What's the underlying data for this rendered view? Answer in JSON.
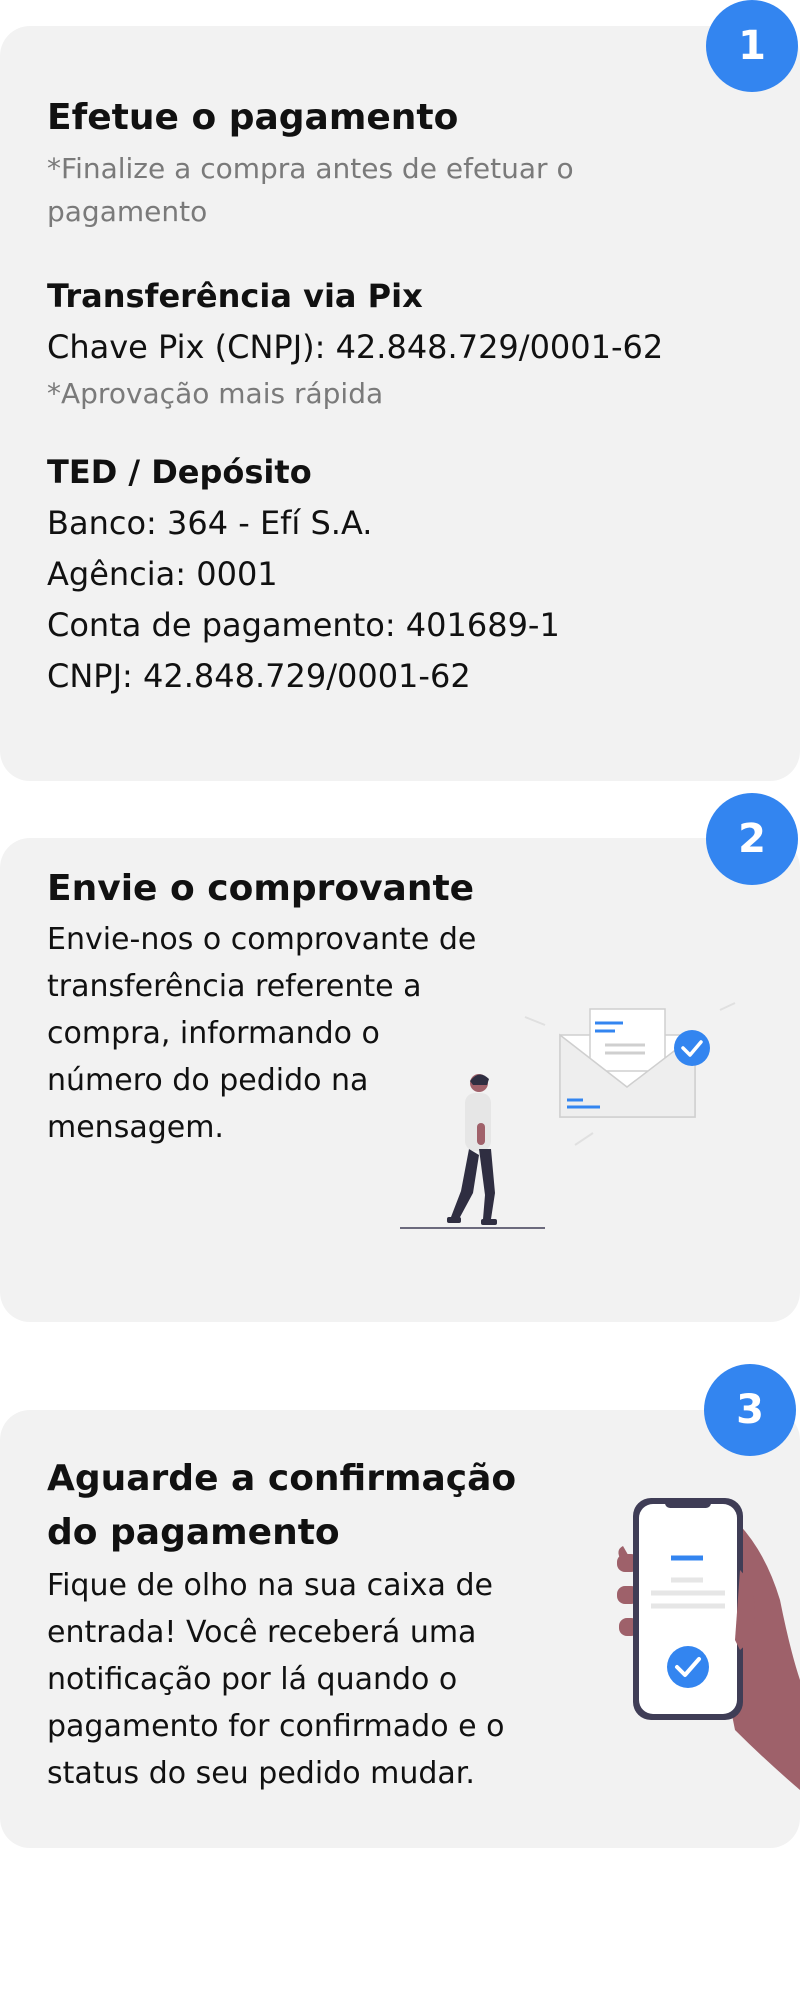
{
  "step1": {
    "number": "1",
    "title": "Efetue o pagamento",
    "note_line1": "*Finalize a compra antes de efetuar o",
    "note_line2": "pagamento",
    "pix": {
      "heading": "Transferência via Pix",
      "key": "Chave Pix (CNPJ): 42.848.729/0001-62",
      "note": "*Aprovação mais rápida"
    },
    "ted": {
      "heading": "TED / Depósito",
      "bank": "Banco: 364 - Efí S.A.",
      "agency": "Agência: 0001",
      "account": "Conta de pagamento: 401689-1",
      "cnpj": "CNPJ: 42.848.729/0001-62"
    }
  },
  "step2": {
    "number": "2",
    "title": "Envie o comprovante",
    "lines": [
      "Envie-nos o comprovante de",
      "transferência referente a",
      "compra, informando o",
      "número do pedido na",
      "mensagem."
    ]
  },
  "step3": {
    "number": "3",
    "title_line1": "Aguarde a confirmação",
    "title_line2": "do pagamento",
    "lines": [
      "Fique de olho na sua caixa de",
      "entrada! Você receberá uma",
      "notificação por lá quando o",
      "pagamento for confirmado e o",
      "status do seu pedido mudar."
    ]
  },
  "colors": {
    "accent": "#3385f0",
    "card": "#f2f2f2",
    "muted": "#7a7a7a",
    "skin": "#a0616a"
  },
  "icons": {
    "step2_illustration": "person-walking-envelope-illustration",
    "step3_illustration": "hand-holding-phone-check-illustration"
  }
}
